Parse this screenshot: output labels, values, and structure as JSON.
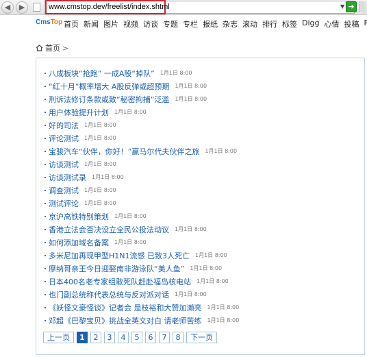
{
  "browser": {
    "url": "www.cmstop.dev/freelist/index.shtml",
    "back_glyph": "◀",
    "forward_glyph": "▶",
    "dropdown_glyph": "▼",
    "go_glyph": "➔"
  },
  "site": {
    "logo_main": "Cms",
    "logo_accent": "Top",
    "nav": [
      "首页",
      "新闻",
      "图片",
      "视频",
      "访谈",
      "专题",
      "专栏",
      "报纸",
      "杂志",
      "滚动",
      "排行",
      "标签",
      "Digg",
      "心情",
      "投稿",
      "RSS"
    ]
  },
  "breadcrumb": {
    "home": "首页",
    "sep": ">"
  },
  "items": [
    {
      "title": "八成板块“抢跑” 一成A股“掉队”",
      "date": "1月1日 8:00"
    },
    {
      "title": "“红十月”概率增大 A股反弹或超预期",
      "date": "1月1日 8:00"
    },
    {
      "title": "刑诉法修订条款或致“秘密拘捕”泛滥",
      "date": "1月1日 8:00"
    },
    {
      "title": "用户体验提升计划",
      "date": "1月1日 8:00"
    },
    {
      "title": "好的司法",
      "date": "1月1日 8:00"
    },
    {
      "title": "评论测试",
      "date": "1月1日 8:00"
    },
    {
      "title": "宝骏汽车“伙伴，你好！”赢马尔代夫伙伴之旅",
      "date": "1月1日 8:00"
    },
    {
      "title": "访谈测试",
      "date": "1月1日 8:00"
    },
    {
      "title": "访谈测试录",
      "date": "1月1日 8:00"
    },
    {
      "title": "调查测试",
      "date": "1月1日 8:00"
    },
    {
      "title": "测试评论",
      "date": "1月1日 8:00"
    },
    {
      "title": "京沪高铁特别策划",
      "date": "1月1日 8:00"
    },
    {
      "title": "香港立法会否决设立全民公投法动议",
      "date": "1月1日 8:00"
    },
    {
      "title": "如何添加域名备案",
      "date": "1月1日 8:00"
    },
    {
      "title": "多米尼加再现甲型H1N1流感 已致3人死亡",
      "date": "1月1日 8:00"
    },
    {
      "title": "摩纳哥亲王今日迎娶南非游泳队“美人鱼”",
      "date": "1月1日 8:00"
    },
    {
      "title": "日本400名老专家组敢死队赶赴福岛核电站",
      "date": "1月1日 8:00"
    },
    {
      "title": "也门副总统称代表总统与反对派对话",
      "date": "1月1日 8:00"
    },
    {
      "title": "《妖怪文豪怪谈》记者会 是枝裕和大赞加濑亮",
      "date": "1月1日 8:00"
    },
    {
      "title": "邓超《巴黎宝贝》挑战全英文对白 请老师苦练",
      "date": "1月1日 8:00"
    }
  ],
  "pager": {
    "prev": "上一页",
    "pages": [
      "1",
      "2",
      "3",
      "4",
      "5",
      "6",
      "7",
      "8"
    ],
    "active": "1",
    "next": "下一页"
  },
  "colors": {
    "link": "#1a5fb0",
    "accent_border": "#bcd4ec",
    "highlight": "#d9232e"
  }
}
